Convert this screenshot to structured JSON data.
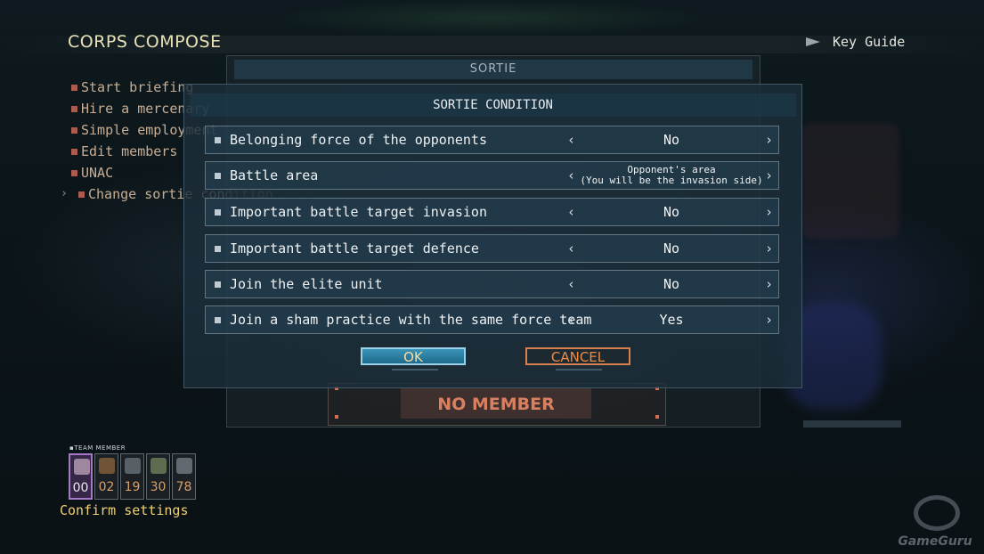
{
  "header": {
    "title": "CORPS COMPOSE",
    "key_guide": "Key Guide"
  },
  "side_menu": {
    "items": [
      {
        "label": "Start briefing"
      },
      {
        "label": "Hire a mercenary"
      },
      {
        "label": "Simple employment"
      },
      {
        "label": "Edit members"
      },
      {
        "label": "UNAC"
      },
      {
        "label": "Change sortie condition"
      }
    ]
  },
  "background_panel": {
    "title": "SORTIE",
    "no_member": "NO MEMBER"
  },
  "dialog": {
    "title": "SORTIE CONDITION",
    "rows": [
      {
        "label": "Belonging force of the opponents",
        "value": "No"
      },
      {
        "label": "Battle area",
        "value_line1": "Opponent's area",
        "value_line2": "(You will be the invasion side)"
      },
      {
        "label": "Important battle target invasion",
        "value": "No"
      },
      {
        "label": "Important battle target defence",
        "value": "No"
      },
      {
        "label": "Join the elite unit",
        "value": "No"
      },
      {
        "label": "Join a sham practice with the same force team",
        "value": "Yes"
      }
    ],
    "arrow_left": "‹",
    "arrow_right": "›",
    "ok_label": "OK",
    "cancel_label": "CANCEL"
  },
  "team": {
    "label": "TEAM MEMBER",
    "slots": [
      "00",
      "02",
      "19",
      "30",
      "78"
    ],
    "confirm": "Confirm settings"
  },
  "watermark": "GameGuru",
  "colors": {
    "accent_ok": "#3a94b8",
    "accent_cancel": "#f08a40",
    "menu_text": "#e8c8a8",
    "title_text": "#e9e2b8"
  }
}
